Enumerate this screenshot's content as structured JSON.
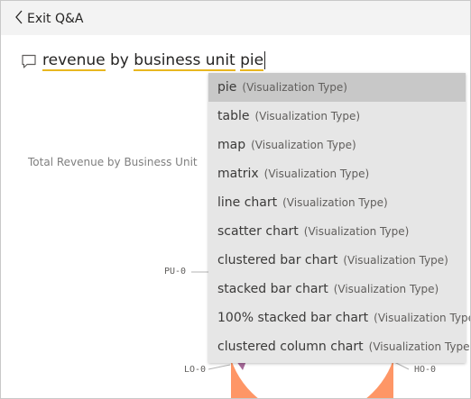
{
  "header": {
    "exit_label": "Exit Q&A"
  },
  "query": {
    "segments": [
      {
        "text": "revenue",
        "underlined": true
      },
      {
        "text": " by ",
        "underlined": false
      },
      {
        "text": "business unit",
        "underlined": true
      },
      {
        "text": " ",
        "underlined": false
      },
      {
        "text": "pie",
        "underlined": true
      }
    ]
  },
  "chart": {
    "title": "Total Revenue by Business Unit",
    "labels": [
      "PU-0",
      "LO-0",
      "HO-0"
    ],
    "colors": {
      "orange": "#fe9666",
      "purple": "#a66999",
      "leader": "#b3b3b3"
    }
  },
  "suggestions": {
    "type_label": "(Visualization Type)",
    "items": [
      "pie",
      "table",
      "map",
      "matrix",
      "line chart",
      "scatter chart",
      "clustered bar chart",
      "stacked bar chart",
      "100% stacked bar chart",
      "clustered column chart"
    ],
    "selected": "pie"
  },
  "colors": {
    "underline": "#e8b720",
    "dropdown_bg": "#e6e6e6",
    "selected_bg": "#c8c8c8"
  }
}
